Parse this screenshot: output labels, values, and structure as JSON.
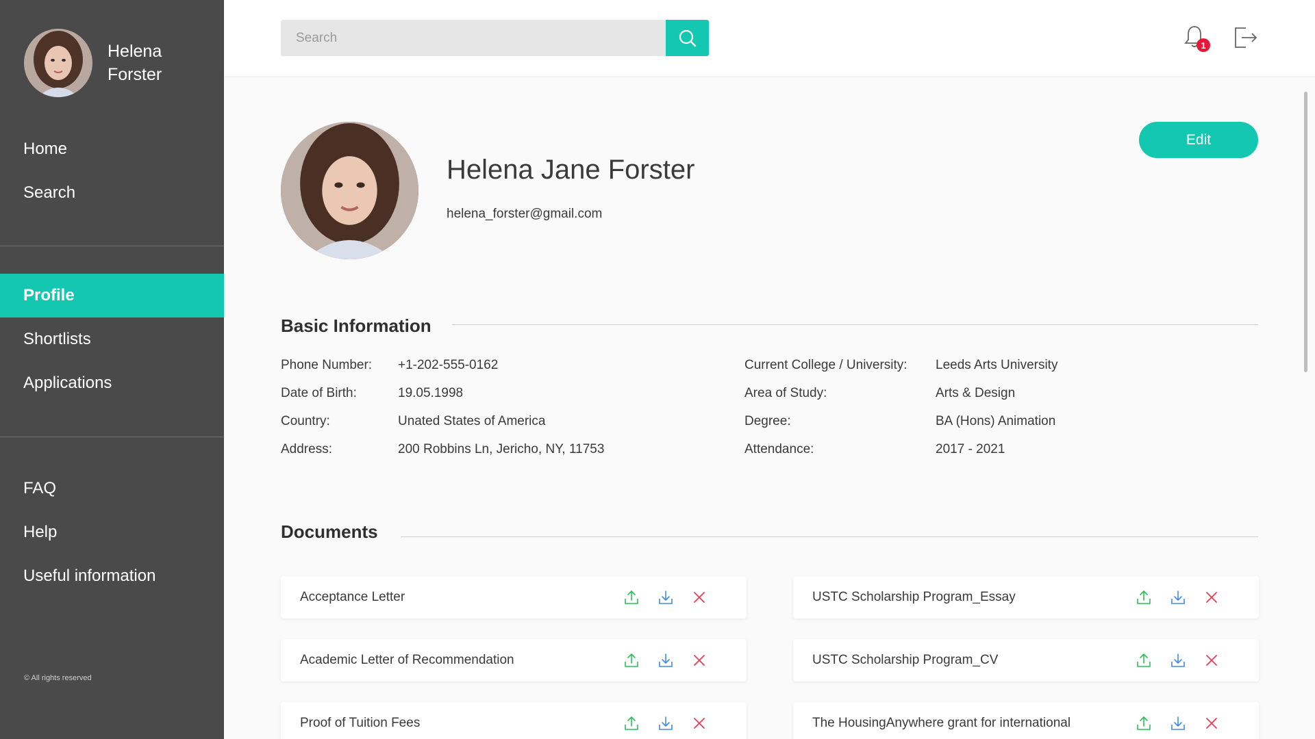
{
  "sidebar": {
    "user_name": "Helena Forster",
    "nav_top": [
      {
        "label": "Home"
      },
      {
        "label": "Search"
      }
    ],
    "nav_mid": [
      {
        "label": "Profile",
        "active": true
      },
      {
        "label": "Shortlists"
      },
      {
        "label": "Applications"
      }
    ],
    "nav_bottom": [
      {
        "label": "FAQ"
      },
      {
        "label": "Help"
      },
      {
        "label": "Useful information"
      }
    ],
    "copyright": "© All rights reserved"
  },
  "header": {
    "search_placeholder": "Search",
    "notification_count": "1"
  },
  "profile": {
    "full_name": "Helena Jane Forster",
    "email": "helena_forster@gmail.com",
    "edit_label": "Edit"
  },
  "basic_info": {
    "title": "Basic Information",
    "left": [
      {
        "label": "Phone Number:",
        "value": "+1-202-555-0162"
      },
      {
        "label": "Date of Birth:",
        "value": "19.05.1998"
      },
      {
        "label": "Country:",
        "value": "Unated States of America"
      },
      {
        "label": "Address:",
        "value": "200 Robbins Ln, Jericho, NY, 11753"
      }
    ],
    "right": [
      {
        "label": "Current College / University:",
        "value": "Leeds Arts University"
      },
      {
        "label": "Area of Study:",
        "value": "Arts & Design"
      },
      {
        "label": "Degree:",
        "value": "BA (Hons) Animation"
      },
      {
        "label": "Attendance:",
        "value": "2017 - 2021"
      }
    ]
  },
  "documents": {
    "title": "Documents",
    "left": [
      "Acceptance Letter",
      "Academic Letter of Recommendation",
      "Proof of Tuition Fees"
    ],
    "right": [
      "USTC Scholarship Program_Essay",
      "USTC Scholarship Program_CV",
      "The HousingAnywhere grant for international"
    ]
  },
  "colors": {
    "accent": "#14c7b0",
    "sidebar_bg": "#4a4a4a",
    "upload_icon": "#2cbf5a",
    "download_icon": "#3d8be6",
    "delete_icon": "#ee3b55",
    "badge": "#e8173a"
  },
  "icons": {
    "search": "search-icon",
    "bell": "bell-icon",
    "logout": "logout-icon",
    "upload": "upload-icon",
    "download": "download-icon",
    "delete": "close-icon"
  }
}
